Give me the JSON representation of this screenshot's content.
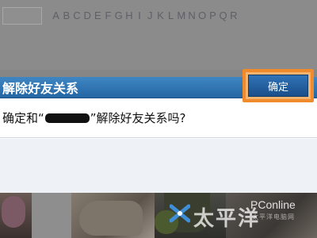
{
  "page": {
    "alphabet": [
      "A",
      "B",
      "C",
      "D",
      "E",
      "F",
      "G",
      "H",
      "I",
      "J",
      "K",
      "L",
      "M",
      "N",
      "O",
      "P",
      "Q",
      "R"
    ]
  },
  "dialog": {
    "title": "解除好友关系",
    "message_before": "确定和“",
    "message_after": "”解除好友关系吗?",
    "confirm_label": "确定"
  },
  "watermark": {
    "text_cn": "太平洋",
    "text_en": "PConline",
    "text_sub": "太平洋电脑网"
  },
  "colors": {
    "header_blue": "#2f74b6",
    "highlight_orange": "#f08a2a"
  }
}
